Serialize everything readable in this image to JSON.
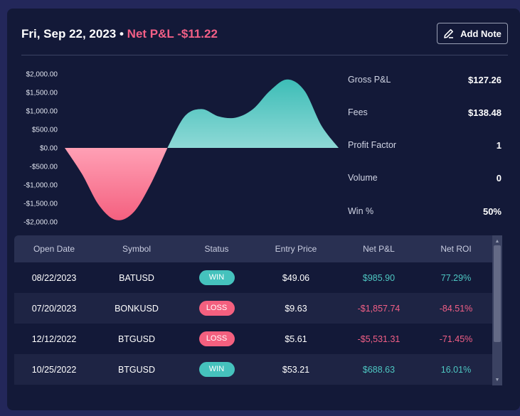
{
  "header": {
    "date": "Fri, Sep 22, 2023",
    "separator": "•",
    "net_pnl": "Net P&L -$11.22",
    "add_note_label": "Add Note"
  },
  "stats": [
    {
      "label": "Gross P&L",
      "value": "$127.26"
    },
    {
      "label": "Fees",
      "value": "$138.48"
    },
    {
      "label": "Profit Factor",
      "value": "1"
    },
    {
      "label": "Volume",
      "value": "0"
    },
    {
      "label": "Win %",
      "value": "50%"
    }
  ],
  "chart_data": {
    "type": "area",
    "y_ticks": [
      "$2,000.00",
      "$1,500.00",
      "$1,000.00",
      "$500.00",
      "$0.00",
      "-$500.00",
      "-$1,000.00",
      "-$1,500.00",
      "-$2,000.00"
    ],
    "ylim": [
      -2000,
      2000
    ],
    "x": [
      0,
      1,
      2,
      3,
      4,
      5,
      6,
      7,
      8,
      9,
      10,
      11,
      12,
      13,
      14,
      15,
      16,
      17,
      18,
      19,
      20
    ],
    "values": [
      0,
      -700,
      -1550,
      -1950,
      -1750,
      -1000,
      0,
      850,
      1050,
      850,
      820,
      1050,
      1550,
      1850,
      1550,
      600,
      0
    ],
    "colors": {
      "positive": "#4ec7c2",
      "negative": "#f25f86"
    },
    "grid": false
  },
  "table": {
    "columns": [
      "Open Date",
      "Symbol",
      "Status",
      "Entry Price",
      "Net P&L",
      "Net ROI"
    ],
    "rows": [
      {
        "open_date": "08/22/2023",
        "symbol": "BATUSD",
        "status": "WIN",
        "entry_price": "$49.06",
        "net_pnl": "$985.90",
        "net_roi": "77.29%"
      },
      {
        "open_date": "07/20/2023",
        "symbol": "BONKUSD",
        "status": "LOSS",
        "entry_price": "$9.63",
        "net_pnl": "-$1,857.74",
        "net_roi": "-84.51%"
      },
      {
        "open_date": "12/12/2022",
        "symbol": "BTGUSD",
        "status": "LOSS",
        "entry_price": "$5.61",
        "net_pnl": "-$5,531.31",
        "net_roi": "-71.45%"
      },
      {
        "open_date": "10/25/2022",
        "symbol": "BTGUSD",
        "status": "WIN",
        "entry_price": "$53.21",
        "net_pnl": "$688.63",
        "net_roi": "16.01%"
      }
    ]
  },
  "icons": {
    "add_note": "edit-icon",
    "scroll_up": "chevron-up-icon",
    "scroll_down": "chevron-down-icon"
  }
}
